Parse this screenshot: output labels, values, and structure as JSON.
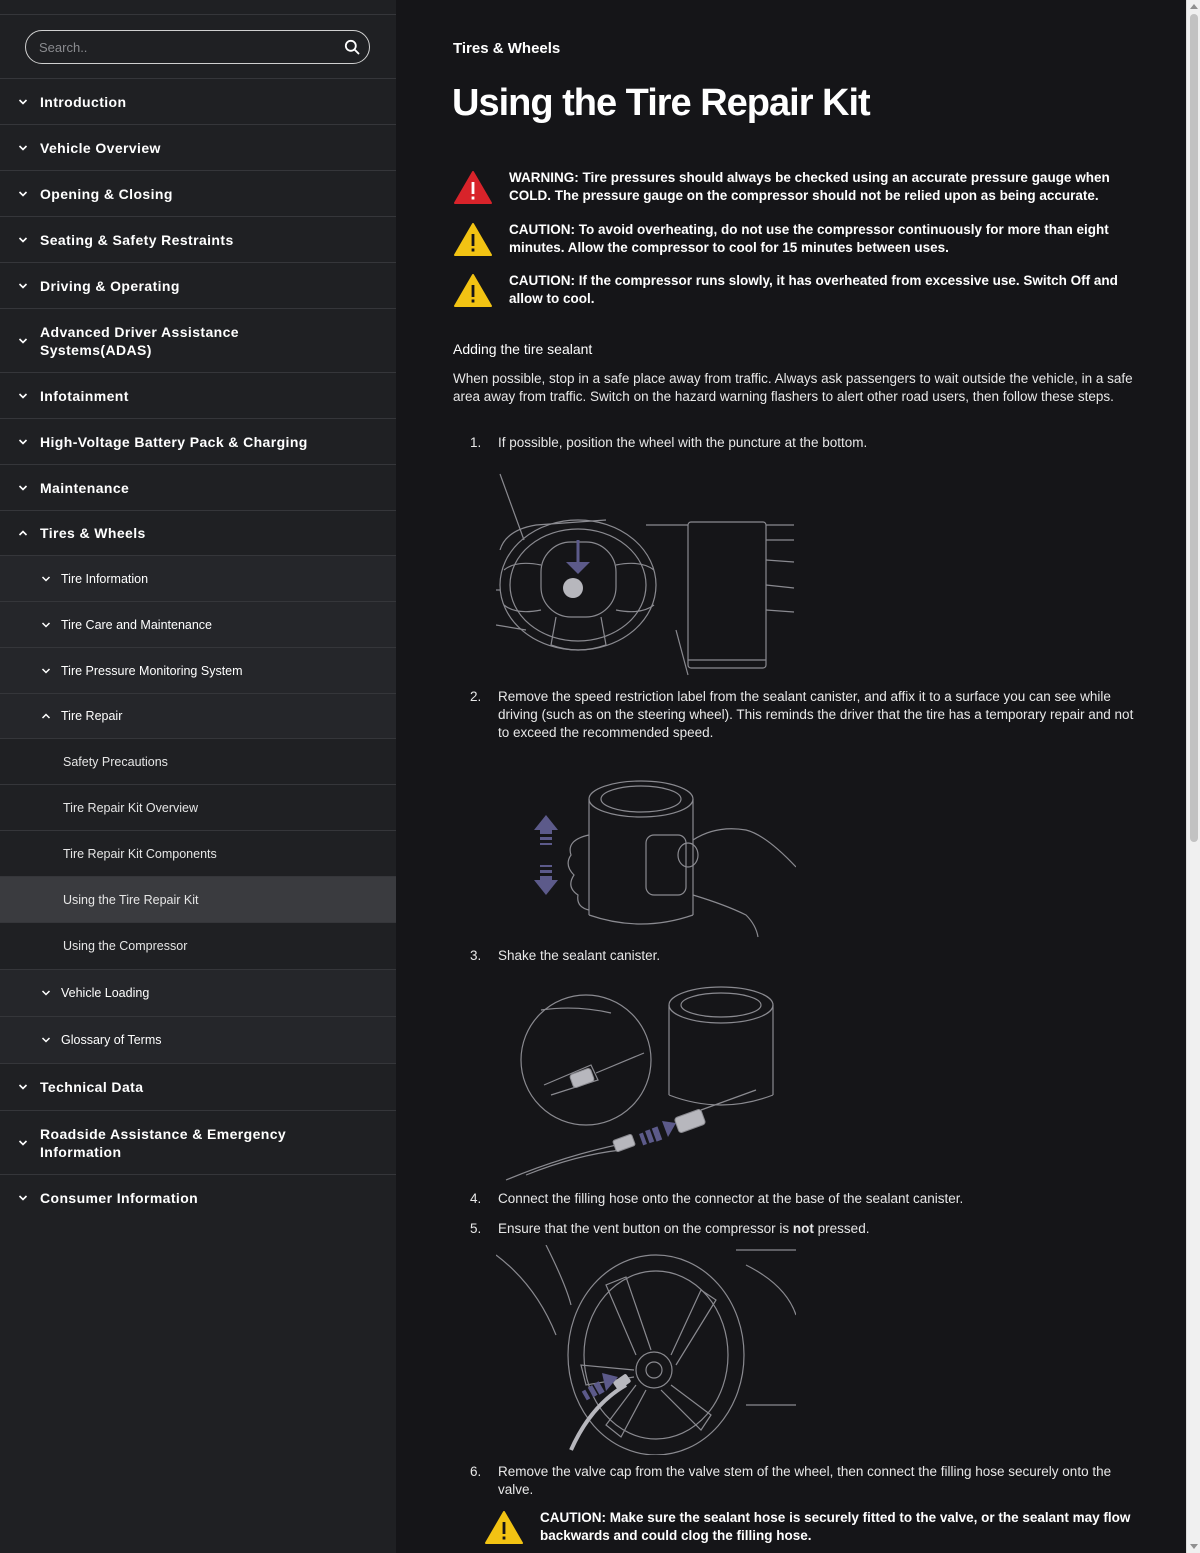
{
  "search": {
    "placeholder": "Search.."
  },
  "nav": {
    "top": [
      "Introduction",
      "Vehicle Overview",
      "Opening & Closing",
      "Seating & Safety Restraints",
      "Driving & Operating",
      "Advanced Driver Assistance Systems(ADAS)",
      "Infotainment",
      "High-Voltage Battery Pack & Charging",
      "Maintenance",
      "Tires & Wheels"
    ],
    "tires_children": [
      "Tire Information",
      "Tire Care and Maintenance",
      "Tire Pressure Monitoring System",
      "Tire Repair"
    ],
    "tire_repair_children": [
      "Safety Precautions",
      "Tire Repair Kit Overview",
      "Tire Repair Kit Components",
      "Using the Tire Repair Kit",
      "Using the Compressor"
    ],
    "tires_children_after": [
      "Vehicle Loading",
      "Glossary of Terms"
    ],
    "bottom": [
      "Technical Data",
      "Roadside Assistance & Emergency Information",
      "Consumer Information"
    ]
  },
  "content": {
    "breadcrumb": "Tires & Wheels",
    "title": "Using the Tire Repair Kit",
    "notices": [
      {
        "type": "warning",
        "text": "WARNING: Tire pressures should always be checked using an accurate pressure gauge when COLD. The pressure gauge on the compressor should not be relied upon as being accurate."
      },
      {
        "type": "caution",
        "text": "CAUTION: To avoid overheating, do not use the compressor continuously for more than eight minutes. Allow the compressor to cool for 15 minutes between uses."
      },
      {
        "type": "caution",
        "text": "CAUTION: If the compressor runs slowly, it has overheated from excessive use. Switch Off and allow to cool."
      }
    ],
    "section_heading": "Adding the tire sealant",
    "intro": "When possible, stop in a safe place away from traffic. Always ask passengers to wait outside the vehicle, in a safe area away from traffic. Switch on the hazard warning flashers to alert other road users, then follow these steps.",
    "steps": [
      {
        "num": "1.",
        "text": "If possible, position the wheel with the puncture at the bottom."
      },
      {
        "num": "2.",
        "text": "Remove the speed restriction label from the sealant canister, and affix it to a surface you can see while driving (such as on the steering wheel). This reminds the driver that the tire has a temporary repair and not to exceed the recommended speed."
      },
      {
        "num": "3.",
        "text": "Shake the sealant canister."
      },
      {
        "num": "4.",
        "text": "Connect the filling hose onto the connector at the base of the sealant canister."
      },
      {
        "num": "5.",
        "text_before": "Ensure that the vent button on the compressor is ",
        "text_bold": "not",
        "text_after": " pressed."
      },
      {
        "num": "6.",
        "text": "Remove the valve cap from the valve stem of the wheel, then connect the filling hose securely onto the valve."
      }
    ],
    "step6_caution": "CAUTION: Make sure the sealant hose is securely fitted to the valve, or the sealant may flow backwards and could clog the filling hose."
  },
  "colors": {
    "warning_red": "#d8232a",
    "caution_yellow": "#f2c313",
    "accent_purple": "#5c5a8a"
  }
}
